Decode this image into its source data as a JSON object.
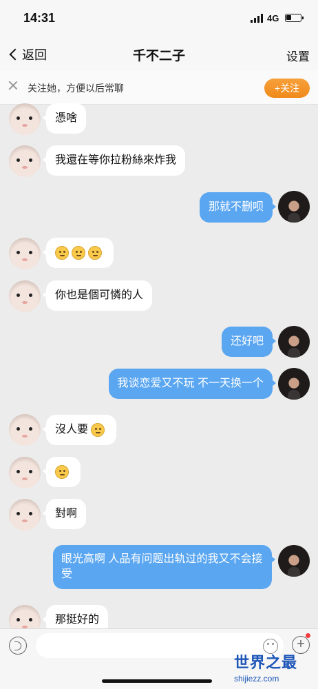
{
  "status_bar": {
    "time": "14:31",
    "network": "4G"
  },
  "nav": {
    "back_label": "返回",
    "title": "千不二子",
    "settings_label": "设置"
  },
  "follow_prompt": {
    "text": "关注她，方便以后常聊",
    "button_label": "+关注"
  },
  "messages": [
    {
      "side": "in",
      "text": "憑啥"
    },
    {
      "side": "in",
      "text": "我還在等你拉粉絲來炸我"
    },
    {
      "side": "out",
      "text": "那就不删呗"
    },
    {
      "side": "in",
      "text": "",
      "emojis": [
        "pray-emoji",
        "pray-emoji",
        "pray-emoji"
      ]
    },
    {
      "side": "in",
      "text": "你也是個可憐的人"
    },
    {
      "side": "out",
      "text": "还好吧"
    },
    {
      "side": "out",
      "text": "我谈恋爱又不玩 不一天换一个"
    },
    {
      "side": "in",
      "text": "沒人要",
      "emojis": [
        "sweat-smile-emoji"
      ]
    },
    {
      "side": "in",
      "text": "",
      "emojis": [
        "puzzled-emoji"
      ]
    },
    {
      "side": "in",
      "text": "對啊"
    },
    {
      "side": "out",
      "text": "眼光高啊 人品有问题出轨过的我又不会接受"
    },
    {
      "side": "in",
      "text": "那挺好的"
    }
  ],
  "input": {
    "placeholder": ""
  },
  "watermark": {
    "title": "世界之最",
    "url": "shijiezz.com"
  },
  "colors": {
    "outgoing_bubble": "#5aa6f1",
    "incoming_bubble": "#ffffff",
    "follow_button": "#f08a1c",
    "watermark": "#1d56b8"
  }
}
